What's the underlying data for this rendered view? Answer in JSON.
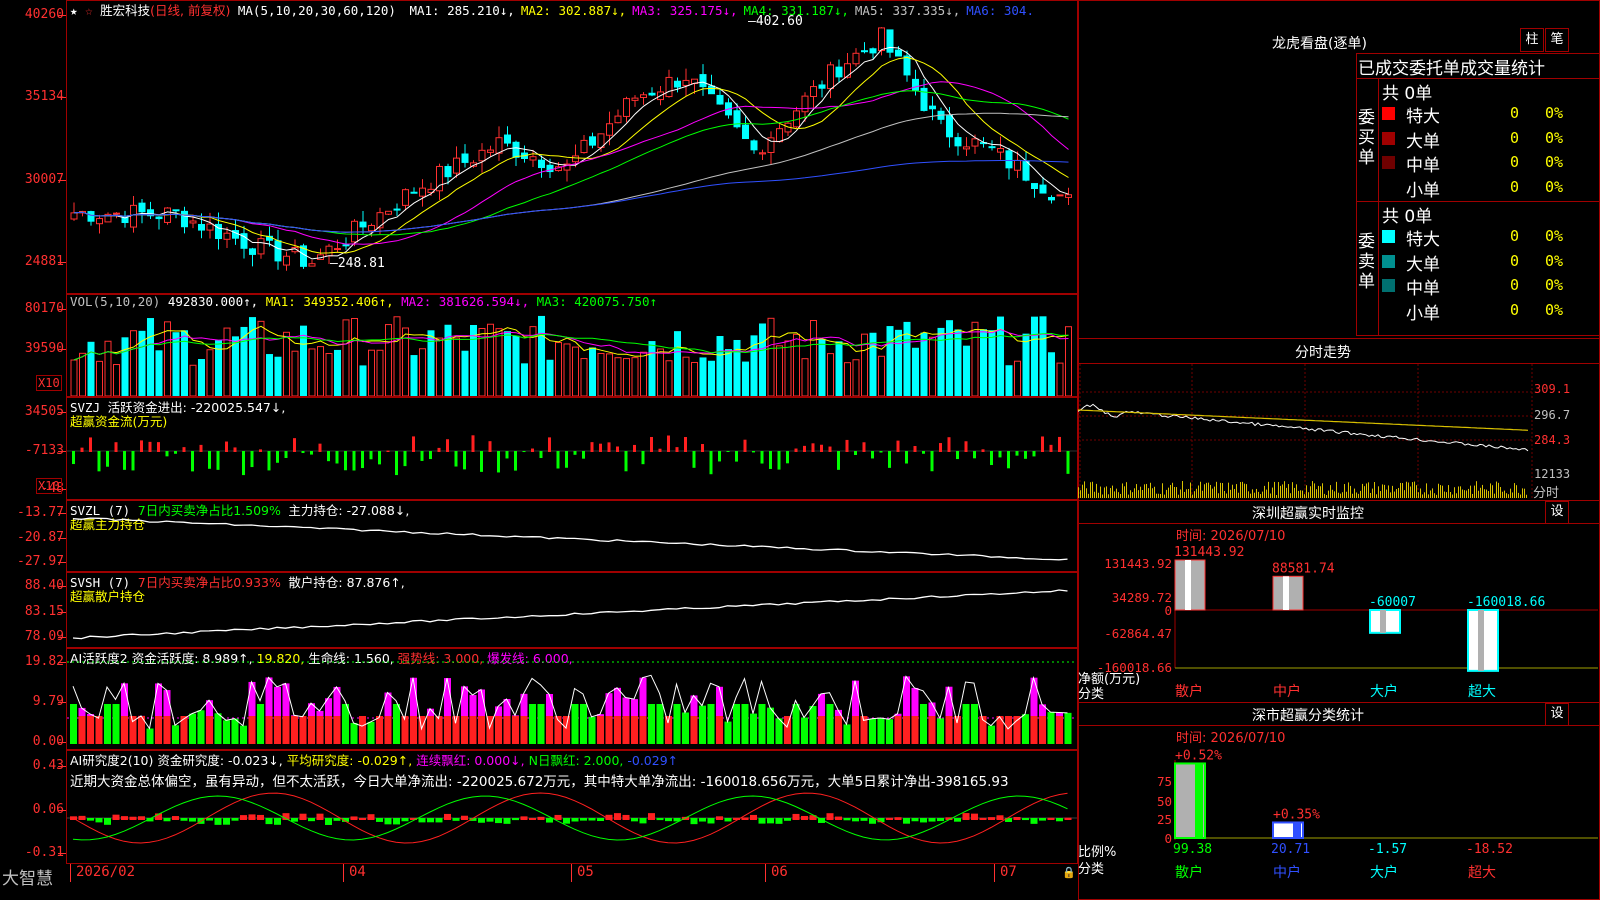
{
  "main_chart": {
    "stock_name": "胜宏科技",
    "period_label": "(日线, 前复权)",
    "ma_header": "MA(5,10,20,30,60,120)",
    "ma_values": [
      {
        "label": "MA1: 285.210↓,",
        "color": "#ffffff"
      },
      {
        "label": "MA2: 302.887↓,",
        "color": "#ffff00"
      },
      {
        "label": "MA3: 325.175↓,",
        "color": "#ff00ff"
      },
      {
        "label": "MA4: 331.187↓,",
        "color": "#00ff00"
      },
      {
        "label": "MA5: 337.335↓,",
        "color": "#c0c0c0"
      },
      {
        "label": "MA6: 304.",
        "color": "#3050ff"
      }
    ],
    "y_labels": [
      "40260",
      "35134",
      "30007",
      "24881"
    ],
    "high_mark": "402.60",
    "low_mark": "248.81"
  },
  "volume_panel": {
    "title": "VOL(5,10,20)",
    "value": "492830.000↑,",
    "ma1": "MA1: 349352.406↑,",
    "ma2": "MA2: 381626.594↓,",
    "ma3": "MA3: 420075.750↑",
    "y_labels": [
      "80170",
      "39590"
    ],
    "unit": "X10"
  },
  "svzj_panel": {
    "title": "SVZJ",
    "line1": "活跃资金进出: -220025.547↓,",
    "line2": "超赢资金流(万元)",
    "y_labels": [
      "34505",
      "-7133",
      "-48"
    ],
    "unit": "X10"
  },
  "svzl_panel": {
    "title": "SVZL (7)",
    "part1": "7日内买卖净占比1.509%",
    "part2": "主力持仓: -27.088↓,",
    "line2": "超赢主力持仓",
    "y_labels": [
      "-13.77",
      "-20.87",
      "-27.97"
    ]
  },
  "svsh_panel": {
    "title": "SVSH (7)",
    "part1": "7日内买卖净占比0.933%",
    "part2": "散户持仓: 87.876↑,",
    "line2": "超赢散户持仓",
    "y_labels": [
      "88.40",
      "83.15",
      "78.09"
    ]
  },
  "ai_active_panel": {
    "title": "AI活跃度2",
    "fund_activity": "资金活跃度: 8.989↑,",
    "v2": "19.820,",
    "life_line": "生命线: 1.560,",
    "strong_line": "强势线: 3.000,",
    "burst_line": "爆发线: 6.000,",
    "y_labels": [
      "19.82",
      "9.79",
      "0.00"
    ]
  },
  "ai_research_panel": {
    "title": "AI研究度2(10)",
    "research": "资金研究度: -0.023↓,",
    "avg_research": "平均研究度: -0.029↑,",
    "red_streak": "连续飘红: 0.000↓,",
    "n_red": "N日飘红: 2.000,",
    "v5": "-0.029↑",
    "comment": "近期大资金总体偏空，虽有异动，但不太活跃，今日大单净流出: -220025.672万元，其中特大单净流出: -160018.656万元，大单5日累计净出-398165.93",
    "y_labels": [
      "0.43",
      "0.06",
      "-0.31"
    ]
  },
  "x_axis": {
    "brand": "大智慧",
    "labels": [
      "2026/02",
      "04",
      "05",
      "06",
      "07"
    ]
  },
  "dragon_tiger": {
    "title": "龙虎看盘(逐单)",
    "btn_bar": "柱",
    "btn_tick": "笔",
    "subtitle": "已成交委托单成交量统计",
    "buy_label": "委买单",
    "buy_total": "共 0单",
    "sell_label": "委卖单",
    "sell_total": "共 0单",
    "buy_rows": [
      {
        "label": "特大",
        "count": "0",
        "pct": "0%",
        "color": "#ff0000"
      },
      {
        "label": "大单",
        "count": "0",
        "pct": "0%",
        "color": "#a00000"
      },
      {
        "label": "中单",
        "count": "0",
        "pct": "0%",
        "color": "#700000"
      },
      {
        "label": "小单",
        "count": "0",
        "pct": "0%",
        "color": "#000000"
      }
    ],
    "sell_rows": [
      {
        "label": "特大",
        "count": "0",
        "pct": "0%",
        "color": "#00ffff"
      },
      {
        "label": "大单",
        "count": "0",
        "pct": "0%",
        "color": "#009090"
      },
      {
        "label": "中单",
        "count": "0",
        "pct": "0%",
        "color": "#007070"
      },
      {
        "label": "小单",
        "count": "0",
        "pct": "0%",
        "color": "#000000"
      }
    ]
  },
  "intraday": {
    "title": "分时走势",
    "y_labels": [
      "309.1",
      "296.7",
      "284.3"
    ],
    "vol_label": "12133",
    "unit_label": "分时"
  },
  "sz_monitor": {
    "title": "深圳超赢实时监控",
    "btn": "设",
    "time": "时间: 2026/07/10",
    "y_labels": [
      "131443.92",
      "34289.72",
      "0",
      "-62864.47",
      "-160018.66"
    ],
    "unit_label": "净额(万元)",
    "cat_label": "分类",
    "chart_data": {
      "type": "bar",
      "categories": [
        "散户",
        "中户",
        "大户",
        "超大"
      ],
      "values": [
        131443.92,
        88581.74,
        -60007,
        -160018.66
      ],
      "value_labels": [
        "131443.92",
        "88581.74",
        "-60007",
        "-160018.66"
      ]
    }
  },
  "sz_classify": {
    "title": "深市超赢分类统计",
    "btn": "设",
    "time": "时间: 2026/07/10",
    "y_labels": [
      "75",
      "50",
      "25",
      "0"
    ],
    "ratio_label": "比例%",
    "cat_label": "分类",
    "chart_data": {
      "type": "bar",
      "categories": [
        "散户",
        "中户",
        "大户",
        "超大"
      ],
      "values": [
        99.38,
        20.71,
        -1.57,
        -18.52
      ],
      "value_labels": [
        "99.38",
        "20.71",
        "-1.57",
        "-18.52"
      ],
      "change_labels": [
        "+0.52%",
        "+0.35%"
      ]
    }
  }
}
